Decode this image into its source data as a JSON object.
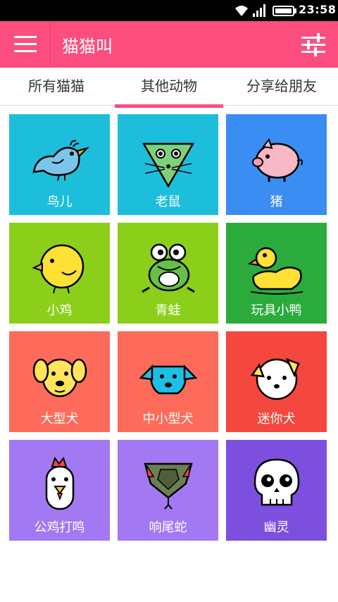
{
  "status_bar": {
    "time": "23:58"
  },
  "app_bar": {
    "title": "猫猫叫"
  },
  "tabs": [
    {
      "label": "所有猫猫"
    },
    {
      "label": "其他动物"
    },
    {
      "label": "分享给朋友"
    }
  ],
  "active_tab": "其他动物",
  "tiles": [
    {
      "label": "鸟儿",
      "color": "#1dbedb",
      "icon": "bird-icon"
    },
    {
      "label": "老鼠",
      "color": "#1dbedb",
      "icon": "mouse-icon"
    },
    {
      "label": "猪",
      "color": "#3a8df3",
      "icon": "pig-icon"
    },
    {
      "label": "小鸡",
      "color": "#8bcf1a",
      "icon": "chick-icon"
    },
    {
      "label": "青蛙",
      "color": "#8bcf1a",
      "icon": "frog-icon"
    },
    {
      "label": "玩具小鸭",
      "color": "#2bab3c",
      "icon": "toy-duck-icon"
    },
    {
      "label": "大型犬",
      "color": "#fe6b5b",
      "icon": "large-dog-icon"
    },
    {
      "label": "中小型犬",
      "color": "#fe6b5b",
      "icon": "medium-dog-icon"
    },
    {
      "label": "迷你犬",
      "color": "#f4473e",
      "icon": "mini-dog-icon"
    },
    {
      "label": "公鸡打鸣",
      "color": "#a378f3",
      "icon": "rooster-icon"
    },
    {
      "label": "响尾蛇",
      "color": "#a378f3",
      "icon": "rattlesnake-icon"
    },
    {
      "label": "幽灵",
      "color": "#7d4fdf",
      "icon": "skull-icon"
    }
  ],
  "colors": {
    "brand": "#fb4e7f"
  }
}
